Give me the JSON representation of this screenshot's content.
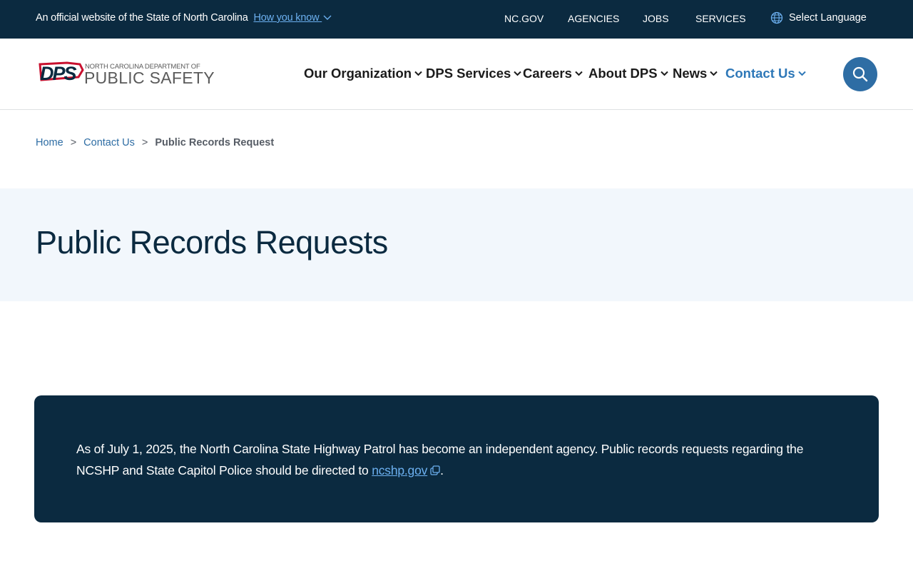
{
  "topbar": {
    "official_text": "An official website of the State of North Carolina",
    "how_you_know": "How you know",
    "links": [
      "NC.GOV",
      "AGENCIES",
      "JOBS",
      "SERVICES"
    ],
    "language": "Select Language"
  },
  "logo": {
    "abbr": "DPS",
    "line1": "NORTH CAROLINA DEPARTMENT OF",
    "line2": "PUBLIC SAFETY"
  },
  "nav": {
    "items": [
      "Our Organization",
      "DPS Services",
      "Careers",
      "About DPS",
      "News",
      "Contact Us"
    ],
    "active": "Contact Us"
  },
  "breadcrumb": {
    "items": [
      "Home",
      "Contact Us"
    ],
    "current": "Public Records Request"
  },
  "page": {
    "title": "Public Records Requests"
  },
  "alert": {
    "text_before": "As of July 1, 2025, the North Carolina State Highway Patrol has become an independent agency. Public records requests regarding the NCSHP and State Capitol Police should be directed to ",
    "link_text": "ncshp.gov",
    "text_after": "."
  },
  "colors": {
    "navy": "#0b2a40",
    "accent_blue": "#2e6da4",
    "light_link": "#6cb0f0",
    "hero_bg": "#f2f7fc"
  }
}
